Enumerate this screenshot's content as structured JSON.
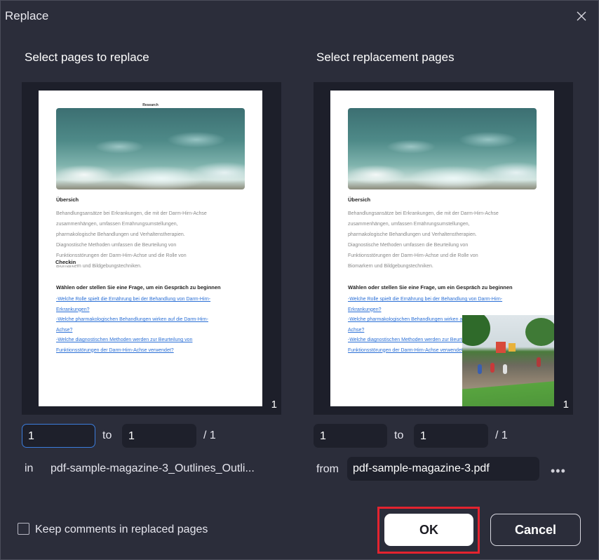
{
  "dialog": {
    "title": "Replace"
  },
  "left": {
    "heading": "Select pages to replace",
    "page_number": "1",
    "from_value": "1",
    "to_label": "to",
    "to_value": "1",
    "total": "/ 1",
    "in_label": "in",
    "file_name": "pdf-sample-magazine-3_Outlines_Outli..."
  },
  "right": {
    "heading": "Select replacement pages",
    "page_number": "1",
    "from_value": "1",
    "to_label": "to",
    "to_value": "1",
    "total": "/ 1",
    "from_label": "from",
    "file_name": "pdf-sample-magazine-3.pdf",
    "more_icon": "more-horizontal-icon"
  },
  "page_content": {
    "research": "Research",
    "heading": "Übersich",
    "body": [
      "Behandlungsansätze bei Erkrankungen, die mit der Darm-Hirn-Achse",
      "zusammenhängen, umfassen Ernährungsumstellungen,",
      "pharmakologische Behandlungen und Verhaltenstherapien.",
      "Diagnostische Methoden umfassen die Beurteilung von",
      "Funktionsstörungen der Darm-Hirn-Achse und die Rolle von",
      "Biomarkern und Bildgebungstechniken."
    ],
    "checkin": "Checkin",
    "question": "Wählen oder stellen Sie eine Frage, um ein Gespräch zu beginnen",
    "links": [
      "-Welche Rolle spielt die Ernährung bei der Behandlung von Darm-Hirn-",
      "Erkrankungen?",
      "-Welche pharmakologischen Behandlungen wirken auf die Darm-Hirn-",
      "Achse?",
      "-Welche diagnostischen Methoden werden zur Beurteilung von",
      "Funktionsstörungen der Darm-Hirn-Achse verwendet?"
    ]
  },
  "footer": {
    "keep_comments_label": "Keep comments in replaced pages",
    "keep_comments_checked": false,
    "ok_label": "OK",
    "cancel_label": "Cancel"
  },
  "colors": {
    "background": "#2b2d3a",
    "input_bg": "#1e202b",
    "focus_border": "#3b7ddd",
    "highlight": "#e3232f"
  }
}
